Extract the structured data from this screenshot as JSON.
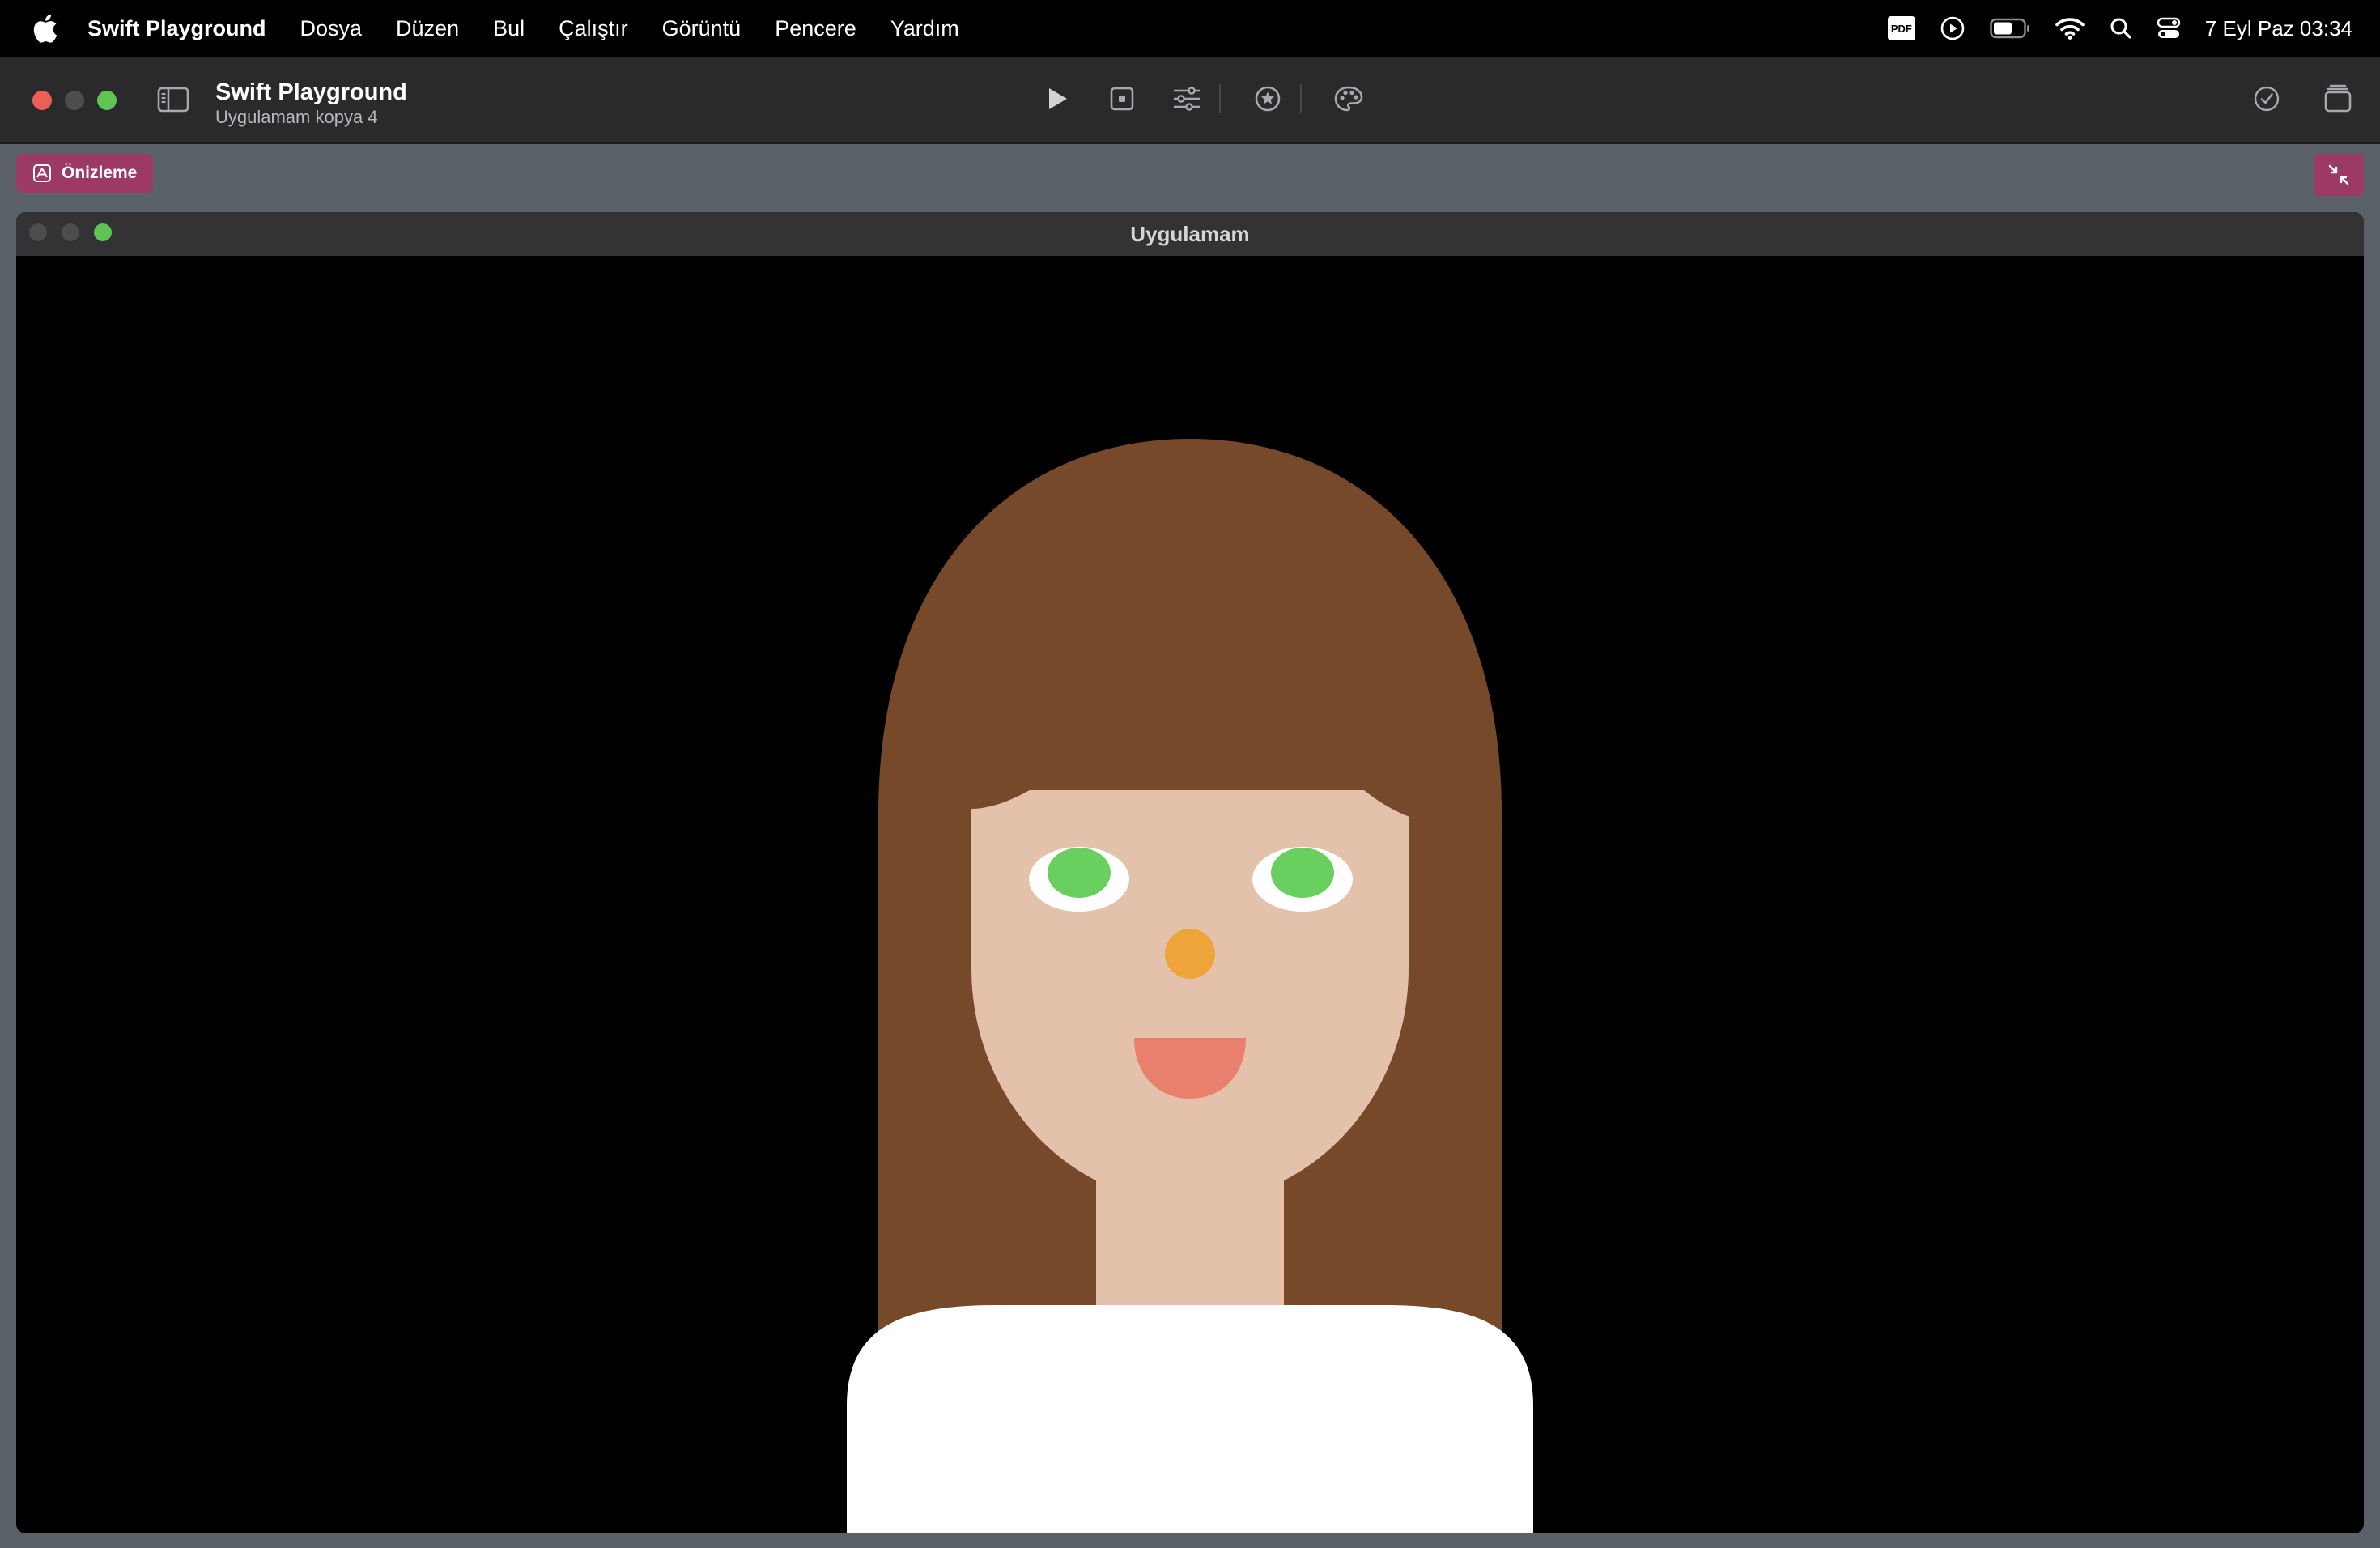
{
  "menubar": {
    "app_name": "Swift Playground",
    "items": [
      "Dosya",
      "Düzen",
      "Bul",
      "Çalıştır",
      "Görüntü",
      "Pencere",
      "Yardım"
    ],
    "status_icons": [
      "pdf-icon",
      "play-circle-icon",
      "battery-icon",
      "wifi-icon",
      "search-icon",
      "control-center-icon"
    ],
    "pdf_label": "PDF",
    "clock": "7 Eyl Paz  03:34"
  },
  "toolbar": {
    "title": "Swift Playground",
    "subtitle": "Uygulamam kopya 4",
    "center_buttons": [
      "play-icon",
      "stop-icon",
      "sliders-icon",
      "star-icon",
      "palette-icon"
    ],
    "right_buttons": [
      "checkmark-icon",
      "stack-icon"
    ]
  },
  "preview": {
    "button_label": "Önizleme",
    "collapse_icon": "collapse-arrows-icon"
  },
  "inner_window": {
    "title": "Uygulamam"
  },
  "avatar": {
    "hair_color": "#76492a",
    "skin_color": "#e3c1ab",
    "eye_white": "#ffffff",
    "iris_color": "#69d05f",
    "nose_color": "#eea33b",
    "mouth_color": "#e9806e",
    "shirt_color": "#ffffff",
    "background": "#000000"
  }
}
